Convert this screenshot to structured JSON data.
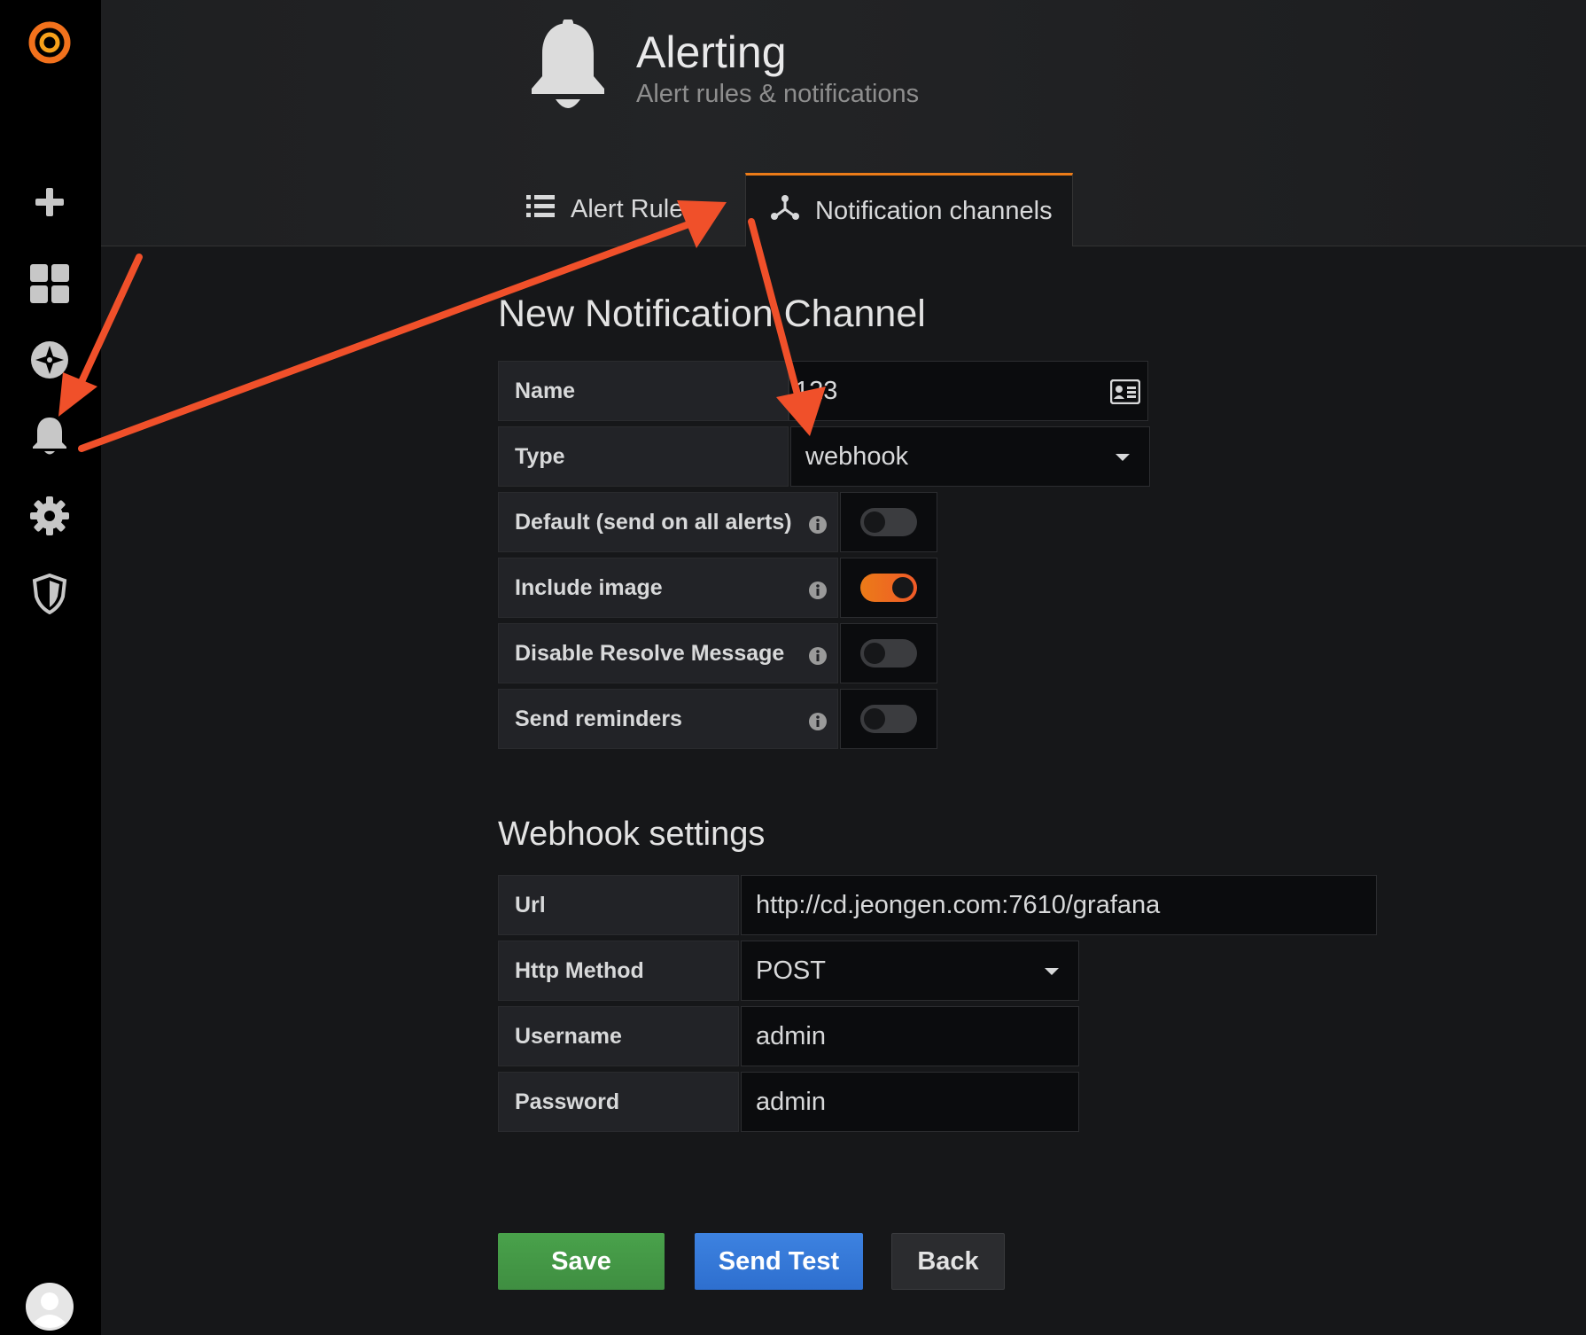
{
  "header": {
    "title": "Alerting",
    "subtitle": "Alert rules & notifications"
  },
  "tabs": [
    {
      "label": "Alert Rules",
      "active": false
    },
    {
      "label": "Notification channels",
      "active": true
    }
  ],
  "sidebar": {
    "items": [
      "grafana-logo-icon",
      "plus-icon",
      "dashboards-icon",
      "explore-icon",
      "bell-icon",
      "gear-icon",
      "shield-icon",
      "avatar"
    ],
    "active": "bell-icon"
  },
  "form": {
    "title": "New Notification Channel",
    "name_label": "Name",
    "name_value": "123",
    "type_label": "Type",
    "type_value": "webhook",
    "toggles": [
      {
        "label": "Default (send on all alerts)",
        "on": false
      },
      {
        "label": "Include image",
        "on": true
      },
      {
        "label": "Disable Resolve Message",
        "on": false
      },
      {
        "label": "Send reminders",
        "on": false
      }
    ]
  },
  "webhook": {
    "title": "Webhook settings",
    "url_label": "Url",
    "url_value": "http://cd.jeongen.com:7610/grafana",
    "method_label": "Http Method",
    "method_value": "POST",
    "username_label": "Username",
    "username_value": "admin",
    "password_label": "Password",
    "password_value": "admin"
  },
  "buttons": {
    "save": "Save",
    "test": "Send Test",
    "back": "Back"
  },
  "colors": {
    "accent": "#eb7b18",
    "arrow": "#f0502a",
    "save": "#3f8e41",
    "test": "#2e6fcf"
  }
}
